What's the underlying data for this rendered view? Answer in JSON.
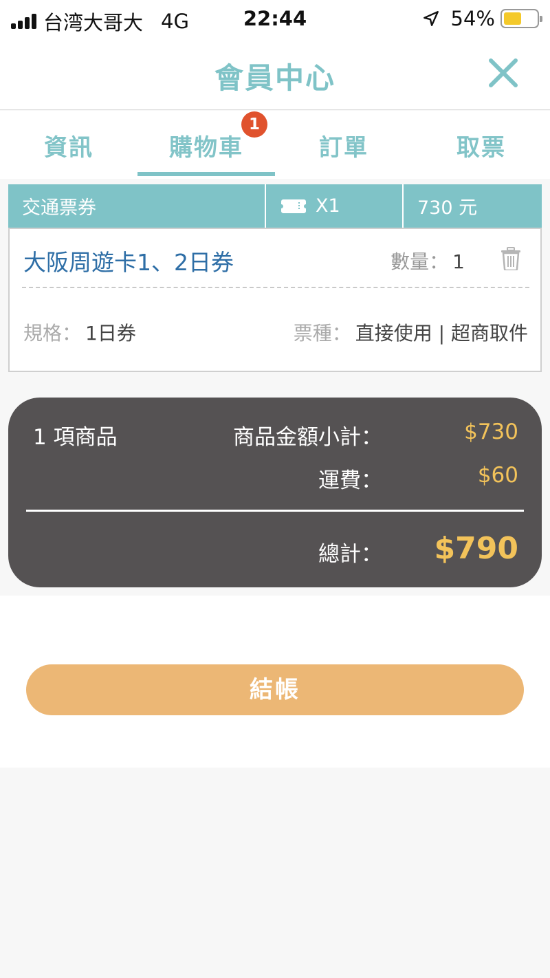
{
  "status_bar": {
    "carrier": "台湾大哥大",
    "network": "4G",
    "time": "22:44",
    "battery": "54%",
    "battery_level": 0.54
  },
  "header": {
    "title": "會員中心",
    "close_icon": "close-icon"
  },
  "tabs": [
    {
      "label": "資訊",
      "active": false
    },
    {
      "label": "購物車",
      "active": true,
      "badge": "1"
    },
    {
      "label": "訂單",
      "active": false
    },
    {
      "label": "取票",
      "active": false
    }
  ],
  "cart": {
    "section": {
      "category": "交通票券",
      "quantity": "X1",
      "price": "730 元"
    },
    "item": {
      "name": "大阪周遊卡1、2日券",
      "qty_label": "數量：",
      "qty_value": "1",
      "spec_label": "規格：",
      "spec_value": "1日券",
      "ticket_type_label": "票種：",
      "ticket_type_value": "直接使用 | 超商取件"
    }
  },
  "summary": {
    "count": "1 項商品",
    "subtotal_label": "商品金額小計：",
    "subtotal_value": "$730",
    "shipping_label": "運費：",
    "shipping_value": "$60",
    "total_label": "總計：",
    "total_value": "$790"
  },
  "checkout": {
    "label": "結帳"
  },
  "colors": {
    "teal": "#7fc3c7",
    "badge": "#e0522d",
    "item_name": "#2e6ea6",
    "summary_bg": "#555253",
    "price_yellow": "#f3c35a",
    "checkout_bg": "#ecb775"
  }
}
